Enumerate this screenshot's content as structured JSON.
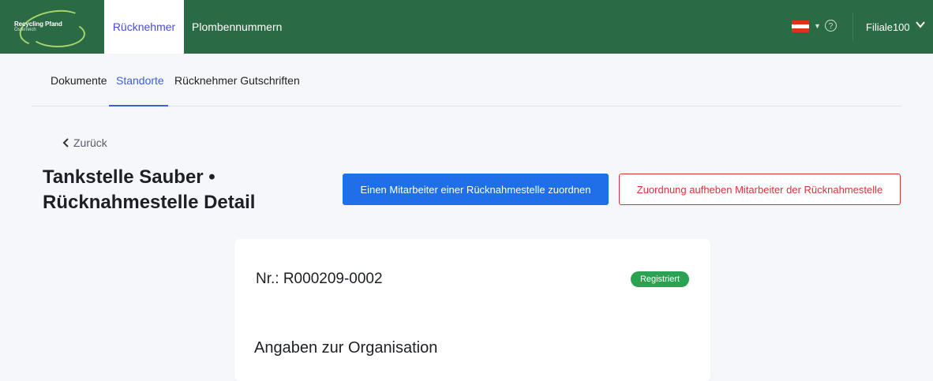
{
  "brand": {
    "name": "Recycling Pfand",
    "sub": "Österreich"
  },
  "top_nav": {
    "tabs": [
      {
        "label": "Rücknehmer",
        "active": true
      },
      {
        "label": "Plombennummern",
        "active": false
      }
    ],
    "user": "Filiale100",
    "help_icon": "?"
  },
  "sub_nav": {
    "items": [
      {
        "label": "Dokumente",
        "active": false
      },
      {
        "label": "Standorte",
        "active": true
      },
      {
        "label": "Rücknehmer Gutschriften",
        "active": false
      }
    ]
  },
  "back": {
    "label": "Zurück"
  },
  "title": {
    "line1": "Tankstelle Sauber •",
    "line2": "Rücknahmestelle Detail"
  },
  "actions": {
    "assign_label": "Einen Mitarbeiter einer Rücknahmestelle zuordnen",
    "unassign_label": "Zuordnung aufheben Mitarbeiter der Rücknahmestelle"
  },
  "card": {
    "number": "Nr.: R000209-0002",
    "status": "Registriert",
    "section_title": "Angaben zur Organisation"
  },
  "colors": {
    "topbar": "#2a6a45",
    "primary": "#1f6fe8",
    "danger": "#d6343a",
    "success": "#2aa251",
    "active_link": "#3d5fd8"
  }
}
